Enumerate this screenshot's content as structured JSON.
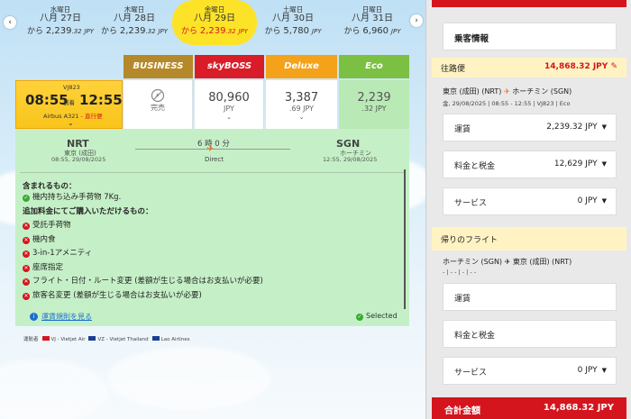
{
  "dates": [
    {
      "dow": "水曜日",
      "dm": "八月 27日",
      "from": "から",
      "amount": "2,239",
      "decimal": ".32",
      "currency": "JPY"
    },
    {
      "dow": "木曜日",
      "dm": "八月 28日",
      "from": "から",
      "amount": "2,239",
      "decimal": ".32",
      "currency": "JPY"
    },
    {
      "dow": "金曜日",
      "dm": "八月 29日",
      "from": "から",
      "amount": "2,239",
      "decimal": ".32",
      "currency": "JPY"
    },
    {
      "dow": "土曜日",
      "dm": "八月 30日",
      "from": "から",
      "amount": "5,780",
      "decimal": "",
      "currency": "JPY"
    },
    {
      "dow": "日曜日",
      "dm": "八月 31日",
      "from": "から",
      "amount": "6,960",
      "decimal": "",
      "currency": "JPY"
    }
  ],
  "nav": {
    "prev": "‹",
    "next": "›"
  },
  "fare_classes": {
    "business": "BUSINESS",
    "boss": "skyBOSS",
    "deluxe": "Deluxe",
    "eco": "Eco"
  },
  "flight": {
    "number": "VJ823",
    "dep_time": "08:55",
    "arrive_label": "到着",
    "arr_time": "12:55",
    "aircraft": "Airbus A321",
    "aircraft_note": " - 直行便"
  },
  "fares": {
    "business": {
      "label": "完売"
    },
    "boss": {
      "amount": "80,960",
      "currency": "JPY"
    },
    "deluxe": {
      "amount": "3,387",
      "currency": ".69 JPY"
    },
    "eco": {
      "amount": "2,239",
      "currency": ".32 JPY"
    }
  },
  "route": {
    "from_code": "NRT",
    "from_city": "東京 (成田)",
    "from_time": "08:55, 29/08/2025",
    "duration": "6 時 0 分",
    "direct": "Direct",
    "to_code": "SGN",
    "to_city": "ホーチミン",
    "to_time": "12:55, 29/08/2025"
  },
  "included": {
    "title": "含まれるもの：",
    "items": [
      "機内持ち込み手荷物 7Kg."
    ],
    "extra_title": "追加料金にてご購入いただけるもの：",
    "extras": [
      "受託手荷物",
      "機内食",
      "3-in-1アメニティ",
      "座席指定",
      "フライト・日付・ルート変更 (差額が生じる場合はお支払いが必要)",
      "旅客名変更 (差額が生じる場合はお支払いが必要)"
    ]
  },
  "rules_link": "運賃規則を見る",
  "selected_label": "Selected",
  "operators": {
    "label": "運航者",
    "vj": "VJ - Vietjet Air",
    "vz": "VZ - Vietjet Thailand",
    "lao": "Lao Airlines"
  },
  "summary": {
    "passenger_info": "乗客情報",
    "outbound_label": "往路便",
    "outbound_amount": "14,868.32 JPY",
    "outbound_route_from": "東京 (成田) (NRT)",
    "outbound_route_to": "ホーチミン (SGN)",
    "outbound_detail": "金, 29/08/2025 | 08:55 - 12:55 | VJ823 | Eco",
    "outbound_lines": [
      {
        "label": "運賃",
        "value": "2,239.32 JPY"
      },
      {
        "label": "料金と税金",
        "value": "12,629 JPY"
      },
      {
        "label": "サービス",
        "value": "0 JPY"
      }
    ],
    "return_label": "帰りのフライト",
    "return_route_from": "ホーチミン (SGN)",
    "return_route_to": "東京 (成田) (NRT)",
    "return_detail": "- | - - | - | - -",
    "return_lines": [
      {
        "label": "運賃",
        "value": ""
      },
      {
        "label": "料金と税金",
        "value": ""
      },
      {
        "label": "サービス",
        "value": "0 JPY"
      }
    ],
    "total_label": "合計金額",
    "total_amount": "14,868.32 JPY"
  },
  "colors": {
    "brand_red": "#d4151e",
    "active_yellow": "#fde327",
    "eco_green": "#7cc043",
    "panel_green": "#c5f0c7"
  }
}
